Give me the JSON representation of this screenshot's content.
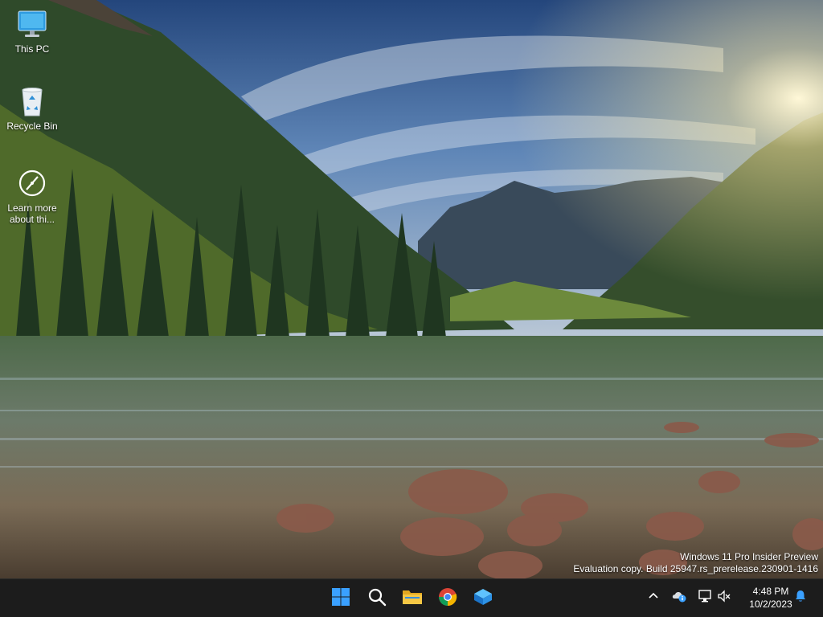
{
  "desktop": {
    "icons": [
      {
        "label": "This PC",
        "icon": "monitor-icon"
      },
      {
        "label": "Recycle Bin",
        "icon": "recycle-bin-icon"
      },
      {
        "label": "Learn more about thi...",
        "icon": "learn-more-icon"
      }
    ],
    "watermark": {
      "line1": "Windows 11 Pro Insider Preview",
      "line2": "Evaluation copy. Build 25947.rs_prerelease.230901-1416"
    }
  },
  "taskbar": {
    "pinned": [
      {
        "name": "start-button",
        "icon": "windows-logo-icon"
      },
      {
        "name": "search-button",
        "icon": "search-icon"
      },
      {
        "name": "file-explorer-button",
        "icon": "folder-icon"
      },
      {
        "name": "chrome-button",
        "icon": "chrome-icon"
      },
      {
        "name": "app-button",
        "icon": "cube-app-icon"
      }
    ],
    "tray": {
      "icons": [
        "chevron-up-icon",
        "onedrive-info-icon",
        "network-icon",
        "volume-muted-icon",
        "notification-bell-icon"
      ],
      "time": "4:48 PM",
      "date": "10/2/2023"
    }
  },
  "colors": {
    "taskbar_bg": "#1c1c1c",
    "accent": "#3aa0ff"
  }
}
